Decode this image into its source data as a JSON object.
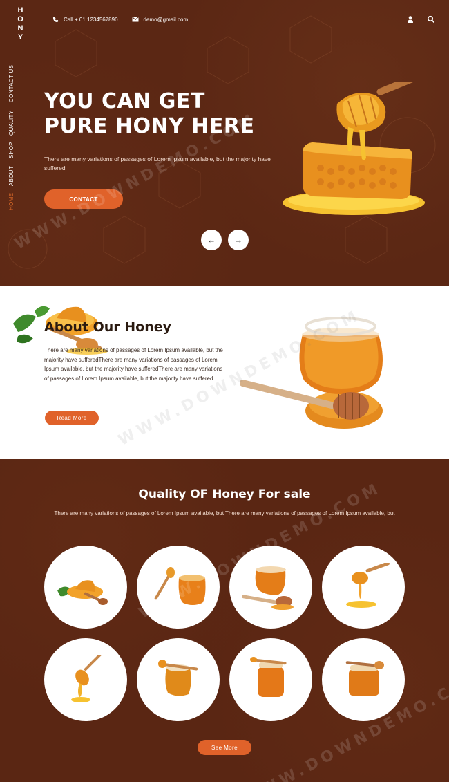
{
  "brand": {
    "letters": [
      "H",
      "O",
      "N",
      "Y"
    ]
  },
  "nav": {
    "items": [
      {
        "label": "CONTACT US",
        "active": false
      },
      {
        "label": "QUALITY",
        "active": false
      },
      {
        "label": "SHOP",
        "active": false
      },
      {
        "label": "ABOUT",
        "active": false
      },
      {
        "label": "HOME",
        "active": true
      }
    ]
  },
  "topbar": {
    "phone": "Call + 01 1234567890",
    "email": "demo@gmail.com",
    "icons": [
      "user-icon",
      "search-icon"
    ]
  },
  "hero": {
    "title_line1": "YOU CAN GET",
    "title_line2": "PURE HONY HERE",
    "text": "There are many variations of passages of Lorem Ipsum available, but the majority have suffered",
    "button": "CONTACT",
    "prev_icon": "←",
    "next_icon": "→"
  },
  "about": {
    "title": "About Our Honey",
    "text": "There are many variations of passages of Lorem Ipsum available, but the majority have sufferedThere are many variations of passages of Lorem Ipsum available, but the majority have sufferedThere are many variations of passages of Lorem Ipsum available, but the majority have suffered",
    "button": "Read More"
  },
  "quality": {
    "title": "Quality OF Honey For sale",
    "text": "There are many variations of passages of Lorem Ipsum available, but There are many variations of passages of Lorem Ipsum available, but",
    "button": "See More",
    "products": [
      "honeycomb-dipper-icon",
      "dipper-jar-icon",
      "honey-pot-icon",
      "dripping-dipper-icon",
      "dipper-drip-icon",
      "jar-dipper-icon",
      "tall-jar-icon",
      "small-jar-icon"
    ]
  },
  "watermark": "WWW.DOWNDEMO.COM",
  "colors": {
    "brown": "#5a2613",
    "orange": "#e0622a",
    "honey": "#f0a020",
    "white": "#ffffff"
  }
}
